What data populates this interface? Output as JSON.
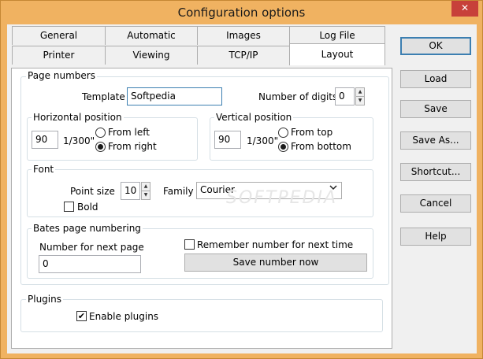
{
  "window": {
    "title": "Configuration options",
    "close_glyph": "✕"
  },
  "tabs": {
    "row1": [
      "General",
      "Automatic",
      "Images",
      "Log File"
    ],
    "row2": [
      "Printer",
      "Viewing",
      "TCP/IP",
      "Layout"
    ],
    "active": "Layout"
  },
  "page_numbers": {
    "group_label": "Page numbers",
    "template_label": "Template",
    "template_value": "Softpedia",
    "digits_label": "Number of digits",
    "digits_value": "0",
    "horizontal": {
      "label": "Horizontal position",
      "value": "90",
      "unit": "1/300\"",
      "option_left": "From left",
      "option_right": "From right",
      "selected": "From right"
    },
    "vertical": {
      "label": "Vertical position",
      "value": "90",
      "unit": "1/300\"",
      "option_top": "From top",
      "option_bottom": "From bottom",
      "selected": "From bottom"
    },
    "font": {
      "label": "Font",
      "point_size_label": "Point size",
      "point_size_value": "10",
      "family_label": "Family",
      "family_value": "Courier",
      "bold_label": "Bold",
      "bold_checked": false
    },
    "bates": {
      "label": "Bates page numbering",
      "next_label": "Number for next page",
      "next_value": "0",
      "remember_label": "Remember number for next time",
      "remember_checked": false,
      "save_number_label": "Save number now"
    }
  },
  "plugins": {
    "group_label": "Plugins",
    "enable_label": "Enable plugins",
    "enable_checked": true
  },
  "buttons": {
    "ok": "OK",
    "load": "Load",
    "save": "Save",
    "save_as": "Save As...",
    "shortcut": "Shortcut...",
    "cancel": "Cancel",
    "help": "Help"
  },
  "icons": {
    "spin_up": "▲",
    "spin_down": "▼",
    "dropdown": "chevron-down-icon",
    "check": "✔"
  },
  "colors": {
    "title_bar": "#f0b261",
    "close_button": "#c7403a",
    "default_button_border": "#3c7fb1"
  }
}
